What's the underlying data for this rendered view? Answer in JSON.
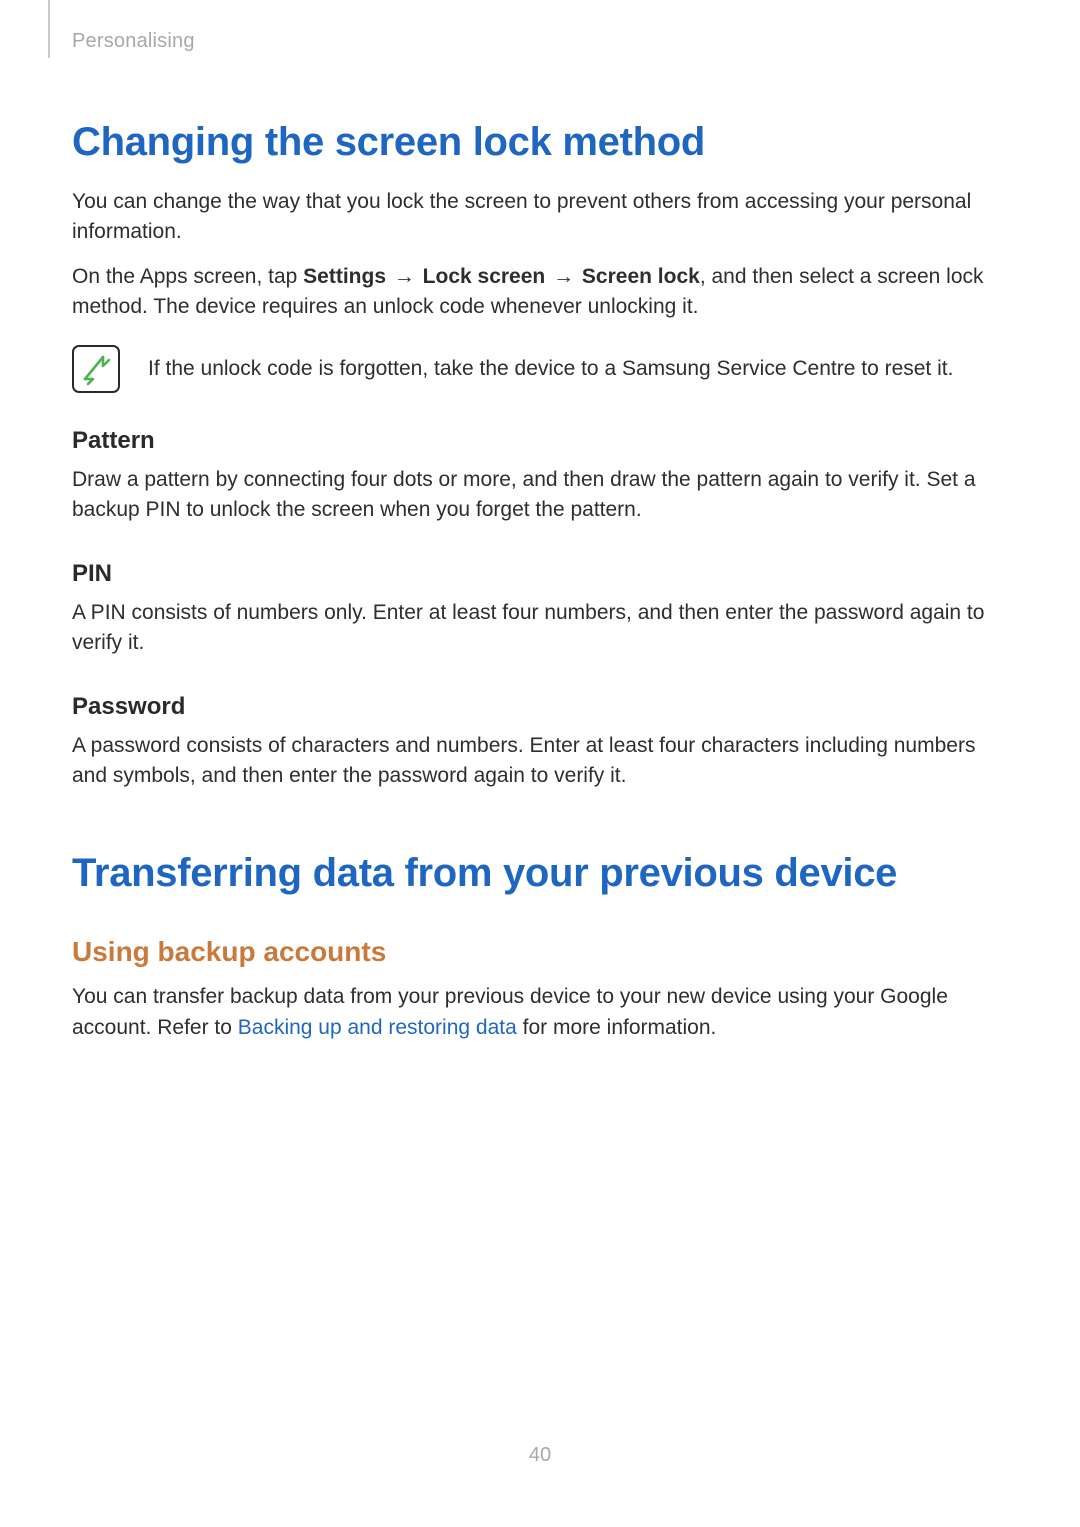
{
  "breadcrumb": "Personalising",
  "page_number": "40",
  "s1": {
    "title": "Changing the screen lock method",
    "intro": "You can change the way that you lock the screen to prevent others from accessing your personal information.",
    "path_pre": "On the Apps screen, tap ",
    "path_b1": "Settings",
    "path_arrow": " → ",
    "path_b2": "Lock screen",
    "path_b3": "Screen lock",
    "path_post": ", and then select a screen lock method. The device requires an unlock code whenever unlocking it.",
    "note": "If the unlock code is forgotten, take the device to a Samsung Service Centre to reset it.",
    "pattern_h": "Pattern",
    "pattern_p": "Draw a pattern by connecting four dots or more, and then draw the pattern again to verify it. Set a backup PIN to unlock the screen when you forget the pattern.",
    "pin_h": "PIN",
    "pin_p": "A PIN consists of numbers only. Enter at least four numbers, and then enter the password again to verify it.",
    "password_h": "Password",
    "password_p": "A password consists of characters and numbers. Enter at least four characters including numbers and symbols, and then enter the password again to verify it."
  },
  "s2": {
    "title": "Transferring data from your previous device",
    "sub": "Using backup accounts",
    "p_pre": "You can transfer backup data from your previous device to your new device using your Google account. Refer to ",
    "p_link": "Backing up and restoring data",
    "p_post": " for more information."
  }
}
